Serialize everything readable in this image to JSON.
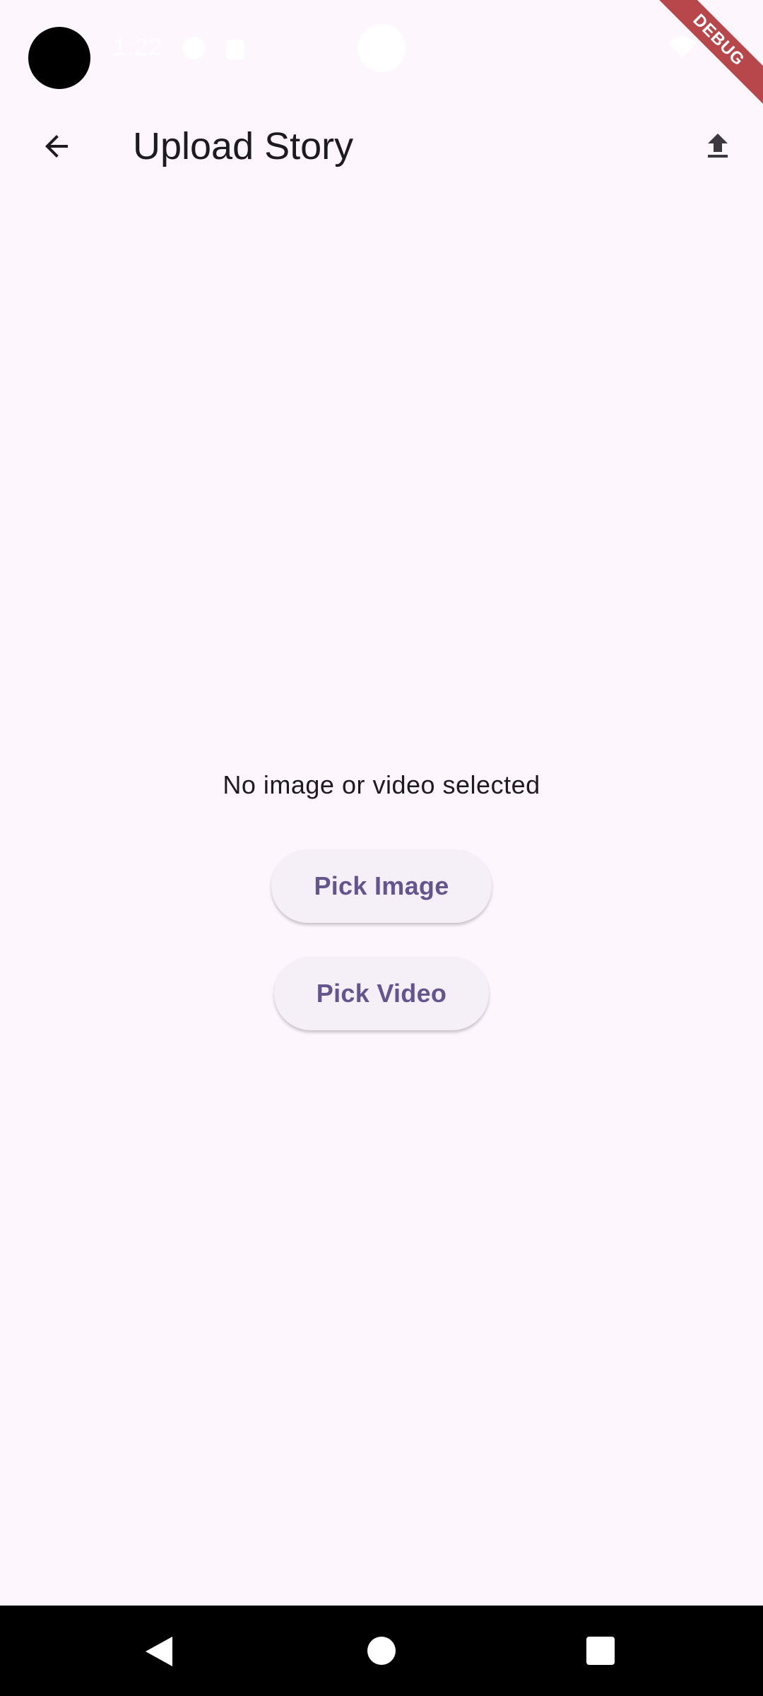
{
  "status_bar": {
    "time": "1:22",
    "icons": [
      "gear-icon",
      "lock-icon",
      "wifi-icon",
      "signal-icon"
    ]
  },
  "debug_banner": {
    "label": "DEBUG",
    "color": "#B8474C"
  },
  "app_bar": {
    "title": "Upload Story",
    "leading_icon": "arrow-back-icon",
    "action_icon": "upload-icon"
  },
  "content": {
    "empty_message": "No image or video selected",
    "pick_image_label": "Pick Image",
    "pick_video_label": "Pick Video"
  },
  "nav_bar": {
    "icons": [
      "nav-back-icon",
      "nav-home-icon",
      "nav-recents-icon"
    ]
  },
  "colors": {
    "background": "#FDF7FD",
    "accent_text": "#65558F",
    "button_background": "#F5EFF7",
    "text": "#1D1B20"
  }
}
